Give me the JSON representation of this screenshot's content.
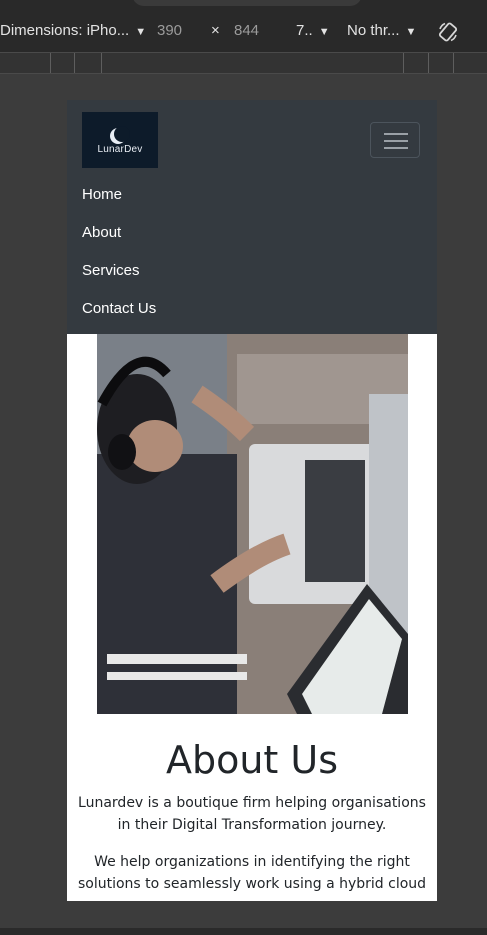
{
  "devtools": {
    "dimensions_label": "Dimensions: iPho...",
    "width_value": "390",
    "times": "×",
    "height_value": "844",
    "zoom_label": "7..",
    "throttle_label": "No thr...",
    "caret": "▼",
    "rotate_icon": "rotate-icon"
  },
  "site": {
    "logo_text": "LunarDev",
    "nav_items": [
      "Home",
      "About",
      "Services",
      "Contact Us"
    ],
    "about": {
      "title": "About Us",
      "para1": "Lunardev is a boutique firm helping organisations in their Digital Transformation journey.",
      "para2": "We help organizations in identifying the right solutions to seamlessly work using a hybrid cloud"
    }
  },
  "colors": {
    "navbar_bg": "#343a40",
    "page_bg": "#ffffff",
    "devtools_bg": "#292929",
    "canvas_bg": "#3c3c3c"
  }
}
